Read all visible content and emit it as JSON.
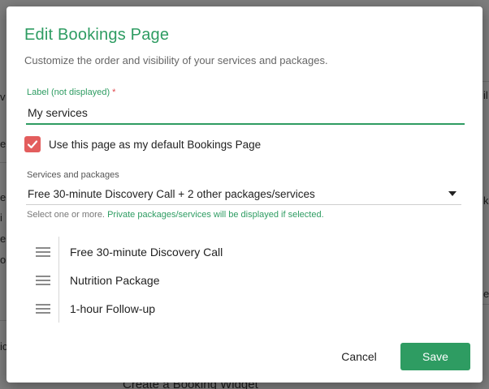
{
  "background": {
    "left_fragments": [
      "v",
      "e",
      "e",
      "i",
      "el",
      "o",
      "ic"
    ],
    "right_fragments": [
      "il",
      "k",
      "e"
    ],
    "bottom_text": "Create a Booking Widget"
  },
  "modal": {
    "title": "Edit Bookings Page",
    "subtitle": "Customize the order and visibility of your services and packages.",
    "label_field": {
      "label": "Label (not displayed)",
      "required_mark": "*",
      "value": "My services"
    },
    "default_checkbox": {
      "checked": true,
      "label": "Use this page as my default Bookings Page"
    },
    "services": {
      "label": "Services and packages",
      "selected_value": "Free 30-minute Discovery Call + 2 other packages/services",
      "help_text": "Select one or more.",
      "help_link": "Private packages/services will be displayed if selected."
    },
    "items": [
      {
        "label": "Free 30-minute Discovery Call"
      },
      {
        "label": "Nutrition Package"
      },
      {
        "label": "1-hour Follow-up"
      }
    ],
    "actions": {
      "cancel_label": "Cancel",
      "save_label": "Save"
    }
  },
  "colors": {
    "accent": "#2e9c62",
    "checkbox": "#e35d5d",
    "required": "#e0474c",
    "overlay": "#7d7d7d"
  }
}
